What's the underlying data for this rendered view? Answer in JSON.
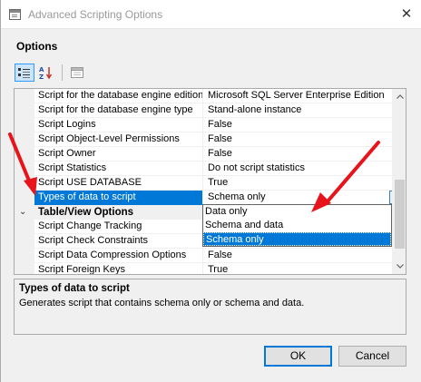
{
  "window": {
    "title": "Advanced Scripting Options",
    "close_glyph": "✕"
  },
  "options_label": "Options",
  "toolbar": {
    "categorized_icon": "categorized-view-icon",
    "alphabetical_icon": "alphabetical-sort-icon",
    "property_pages_icon": "property-pages-icon"
  },
  "grid": {
    "rows_top": [
      {
        "name": "Script for the database engine edition",
        "value": "Microsoft SQL Server Enterprise Edition"
      },
      {
        "name": "Script for the database engine type",
        "value": "Stand-alone instance"
      },
      {
        "name": "Script Logins",
        "value": "False"
      },
      {
        "name": "Script Object-Level Permissions",
        "value": "False"
      },
      {
        "name": "Script Owner",
        "value": "False"
      },
      {
        "name": "Script Statistics",
        "value": "Do not script statistics"
      },
      {
        "name": "Script USE DATABASE",
        "value": "True"
      },
      {
        "name": "Types of data to script",
        "value": "Schema only"
      }
    ],
    "category": {
      "toggle": "⌄",
      "label": "Table/View Options"
    },
    "rows_bottom": [
      {
        "name": "Script Change Tracking",
        "value": ""
      },
      {
        "name": "Script Check Constraints",
        "value": ""
      },
      {
        "name": "Script Data Compression Options",
        "value": "False"
      },
      {
        "name": "Script Foreign Keys",
        "value": "True"
      }
    ]
  },
  "dropdown": {
    "options": [
      "Data only",
      "Schema and data",
      "Schema only"
    ],
    "highlighted": "Schema only"
  },
  "description": {
    "title": "Types of data to script",
    "text": "Generates script that contains schema only or schema and data."
  },
  "buttons": {
    "ok": "OK",
    "cancel": "Cancel"
  },
  "colors": {
    "selection": "#0078d7",
    "annotation_arrow": "#e8141b"
  }
}
